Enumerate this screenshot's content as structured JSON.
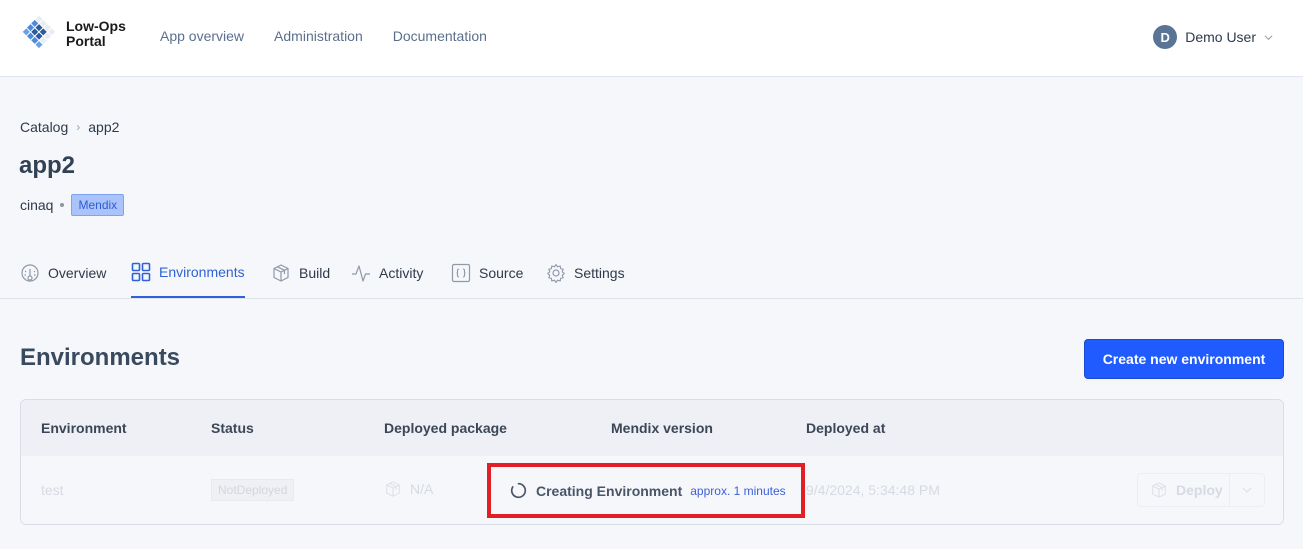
{
  "header": {
    "logo_line1": "Low-Ops",
    "logo_line2": "Portal",
    "nav": [
      "App overview",
      "Administration",
      "Documentation"
    ],
    "user": {
      "initial": "D",
      "name": "Demo User"
    }
  },
  "breadcrumb": [
    "Catalog",
    "app2"
  ],
  "page": {
    "title": "app2",
    "owner": "cinaq",
    "platform_badge": "Mendix"
  },
  "tabs": [
    {
      "label": "Overview",
      "icon": "gauge-icon",
      "active": false
    },
    {
      "label": "Environments",
      "icon": "grid-icon",
      "active": true
    },
    {
      "label": "Build",
      "icon": "package-icon",
      "active": false
    },
    {
      "label": "Activity",
      "icon": "activity-icon",
      "active": false
    },
    {
      "label": "Source",
      "icon": "code-braces-icon",
      "active": false
    },
    {
      "label": "Settings",
      "icon": "gear-icon",
      "active": false
    }
  ],
  "environments": {
    "title": "Environments",
    "create_button": "Create new environment",
    "columns": [
      "Environment",
      "Status",
      "Deployed package",
      "Mendix version",
      "Deployed at"
    ],
    "rows": [
      {
        "environment": "test",
        "status": "NotDeployed",
        "package": "N/A",
        "mendix_version": "",
        "deployed_at": "9/4/2024, 5:34:48 PM",
        "action": "Deploy"
      }
    ],
    "overlay": {
      "label": "Creating Environment",
      "eta": "approx. 1 minutes"
    }
  },
  "colors": {
    "primary": "#1f5bff",
    "active_tab": "#2f62d6",
    "highlight": "#e01f27",
    "badge_bg": "#aac4fb"
  }
}
